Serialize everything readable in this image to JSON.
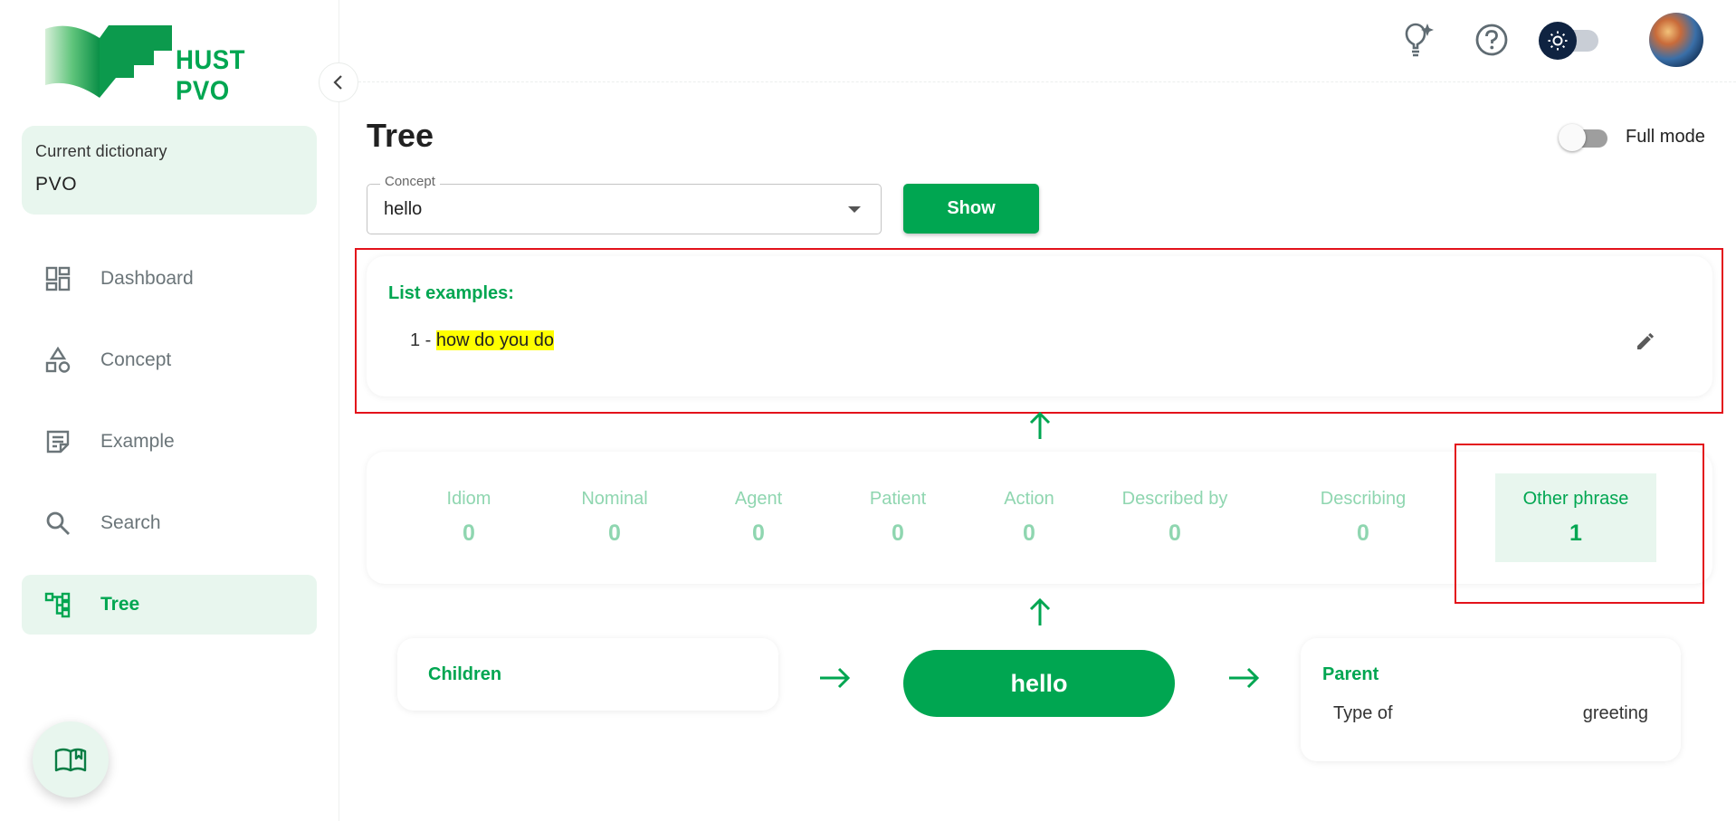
{
  "brand": {
    "name": "HUST PVO",
    "color": "#00a651"
  },
  "sidebar": {
    "dictionary_label": "Current dictionary",
    "dictionary_value": "PVO",
    "items": [
      {
        "label": "Dashboard",
        "icon": "dashboard-icon",
        "active": false
      },
      {
        "label": "Concept",
        "icon": "shapes-icon",
        "active": false
      },
      {
        "label": "Example",
        "icon": "note-icon",
        "active": false
      },
      {
        "label": "Search",
        "icon": "search-icon",
        "active": false
      },
      {
        "label": "Tree",
        "icon": "tree-icon",
        "active": true
      }
    ],
    "fab_icon": "book-icon"
  },
  "header": {
    "icons": [
      "lightbulb-icon",
      "help-icon",
      "theme-toggle",
      "avatar"
    ]
  },
  "main": {
    "title": "Tree",
    "full_mode_label": "Full mode",
    "full_mode_on": false,
    "concept_field": {
      "label": "Concept",
      "value": "hello"
    },
    "show_button": "Show",
    "examples": {
      "title": "List examples:",
      "items": [
        {
          "index": "1 -",
          "text": "how do you do"
        }
      ]
    },
    "stats": [
      {
        "name": "Idiom",
        "count": "0"
      },
      {
        "name": "Nominal",
        "count": "0"
      },
      {
        "name": "Agent",
        "count": "0"
      },
      {
        "name": "Patient",
        "count": "0"
      },
      {
        "name": "Action",
        "count": "0"
      },
      {
        "name": "Described by",
        "count": "0"
      },
      {
        "name": "Describing",
        "count": "0"
      },
      {
        "name": "Other phrase",
        "count": "1",
        "active": true
      }
    ],
    "children": {
      "title": "Children"
    },
    "center_concept": "hello",
    "parent": {
      "title": "Parent",
      "relation": "Type of",
      "value": "greeting"
    }
  }
}
